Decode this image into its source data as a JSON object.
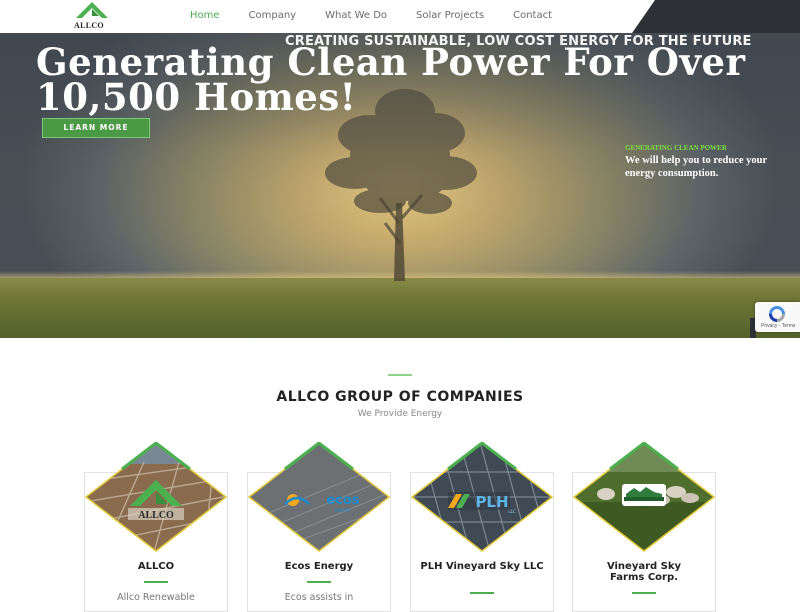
{
  "nav": {
    "logo_text": "ALLCO",
    "items": [
      {
        "label": "Home",
        "active": true
      },
      {
        "label": "Company",
        "active": false
      },
      {
        "label": "What We Do",
        "active": false
      },
      {
        "label": "Solar Projects",
        "active": false
      },
      {
        "label": "Contact",
        "active": false
      }
    ]
  },
  "hero": {
    "tagline": "CREATING SUSTAINABLE, LOW COST ENERGY FOR THE FUTURE",
    "title": "Generating Clean Power For Over 10,500 Homes!",
    "button_label": "LEARN MORE",
    "side_tag": "GENERATING CLEAN POWER",
    "side_text": "We will help you to reduce your energy consumption."
  },
  "recaptcha": {
    "text": "Privacy - Terms"
  },
  "companies": {
    "title": "ALLCO GROUP OF COMPANIES",
    "subtitle": "We Provide Energy",
    "cards": [
      {
        "name": "ALLCO",
        "logo": "ALLCO",
        "desc": "Allco Renewable"
      },
      {
        "name": "Ecos Energy",
        "logo": "ecos",
        "logo_sub": "ENERGY",
        "desc": "Ecos assists in"
      },
      {
        "name": "PLH Vineyard Sky LLC",
        "logo": "PLH",
        "logo_sub": "LLC",
        "desc": ""
      },
      {
        "name": "Vineyard Sky Farms Corp.",
        "logo": "VINEYARD SKY",
        "logo_sub": "FARMS",
        "desc": ""
      }
    ]
  },
  "colors": {
    "accent": "#4caf50",
    "nav_dark": "#2d3135",
    "button": "#4a9a45",
    "side_tag": "#7be03a",
    "diamond_border": "#e3c93a"
  }
}
